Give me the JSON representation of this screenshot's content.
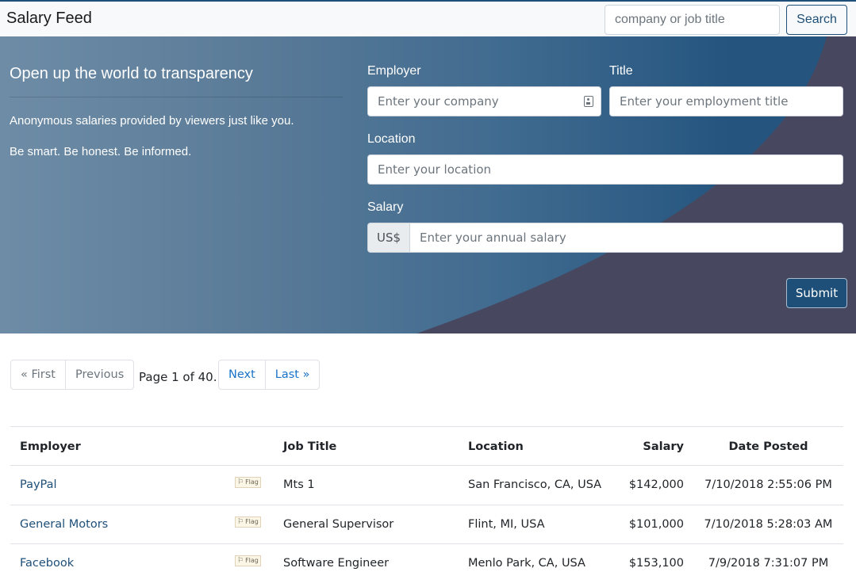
{
  "navbar": {
    "brand": "Salary Feed",
    "search_placeholder": "company or job title",
    "search_button": "Search"
  },
  "hero": {
    "tagline": "Open up the world to transparency",
    "line1": "Anonymous salaries provided by viewers just like you.",
    "line2": "Be smart. Be honest. Be informed.",
    "colors": {
      "accent": "#1e4f78",
      "curve": "#474860"
    }
  },
  "form": {
    "employer_label": "Employer",
    "employer_placeholder": "Enter your company",
    "title_label": "Title",
    "title_placeholder": "Enter your employment title",
    "location_label": "Location",
    "location_placeholder": "Enter your location",
    "salary_label": "Salary",
    "currency_addon": "US$",
    "salary_placeholder": "Enter your annual salary",
    "submit": "Submit"
  },
  "pagination": {
    "first": "« First",
    "previous": "Previous",
    "info": "Page 1 of 40.",
    "next": "Next",
    "last": "Last »"
  },
  "table": {
    "headers": [
      "Employer",
      "Job Title",
      "Location",
      "Salary",
      "Date Posted"
    ],
    "flag_label": "Flag",
    "rows": [
      {
        "employer": "PayPal",
        "job": "Mts 1",
        "location": "San Francisco, CA, USA",
        "salary": "$142,000",
        "date": "7/10/2018 2:55:06 PM"
      },
      {
        "employer": "General Motors",
        "job": "General Supervisor",
        "location": "Flint, MI, USA",
        "salary": "$101,000",
        "date": "7/10/2018 5:28:03 AM"
      },
      {
        "employer": "Facebook",
        "job": "Software Engineer",
        "location": "Menlo Park, CA, USA",
        "salary": "$153,100",
        "date": "7/9/2018 7:31:07 PM"
      }
    ]
  }
}
